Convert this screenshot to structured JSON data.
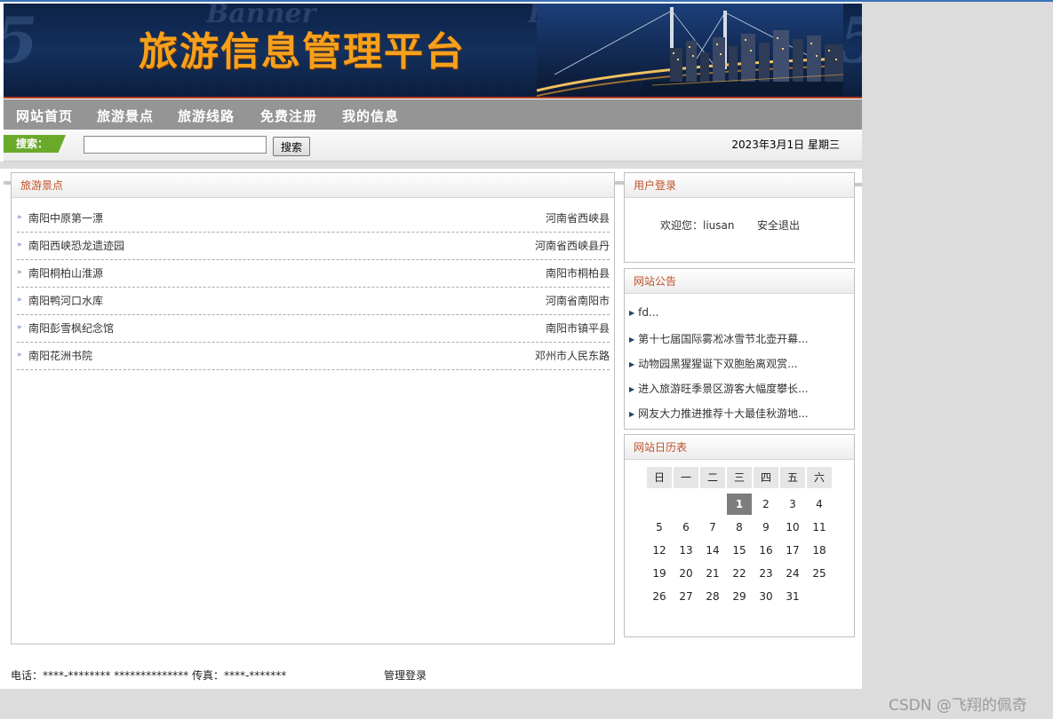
{
  "banner": {
    "title": "旅游信息管理平台",
    "watermark_word": "Banner"
  },
  "nav": {
    "items": [
      "网站首页",
      "旅游景点",
      "旅游线路",
      "免费注册",
      "我的信息"
    ]
  },
  "search": {
    "label": "搜索：",
    "value": "",
    "button": "搜索",
    "date": "2023年3月1日 星期三"
  },
  "spots": {
    "title": "旅游景点",
    "items": [
      {
        "name": "南阳中原第一漂",
        "location": "河南省西峡县"
      },
      {
        "name": "南阳西峡恐龙遗迹园",
        "location": "河南省西峡县丹"
      },
      {
        "name": "南阳桐柏山淮源",
        "location": "南阳市桐柏县"
      },
      {
        "name": "南阳鸭河口水库",
        "location": "河南省南阳市"
      },
      {
        "name": "南阳彭雪枫纪念馆",
        "location": "南阳市镇平县"
      },
      {
        "name": "南阳花洲书院",
        "location": "邓州市人民东路"
      }
    ]
  },
  "login": {
    "title": "用户登录",
    "welcome": "欢迎您：liusan",
    "logout": "安全退出"
  },
  "notices": {
    "title": "网站公告",
    "items": [
      "fd...",
      "第十七届国际雾凇冰雪节北壶开幕...",
      "动物园黑猩猩诞下双胞胎离观赏...",
      "进入旅游旺季景区游客大幅度攀长...",
      "网友大力推进推荐十大最佳秋游地..."
    ]
  },
  "calendar": {
    "title": "网站日历表",
    "weekdays": [
      "日",
      "一",
      "二",
      "三",
      "四",
      "五",
      "六"
    ],
    "days": [
      "1",
      "2",
      "3",
      "4",
      "5",
      "6",
      "7",
      "8",
      "9",
      "10",
      "11",
      "12",
      "13",
      "14",
      "15",
      "16",
      "17",
      "18",
      "19",
      "20",
      "21",
      "22",
      "23",
      "24",
      "25",
      "26",
      "27",
      "28",
      "29",
      "30",
      "31"
    ],
    "today": "1"
  },
  "footer": {
    "contact": "电话：****-******** ************** 传真：****-*******",
    "admin": "管理登录"
  },
  "watermark": "CSDN @飞翔的佩奇"
}
